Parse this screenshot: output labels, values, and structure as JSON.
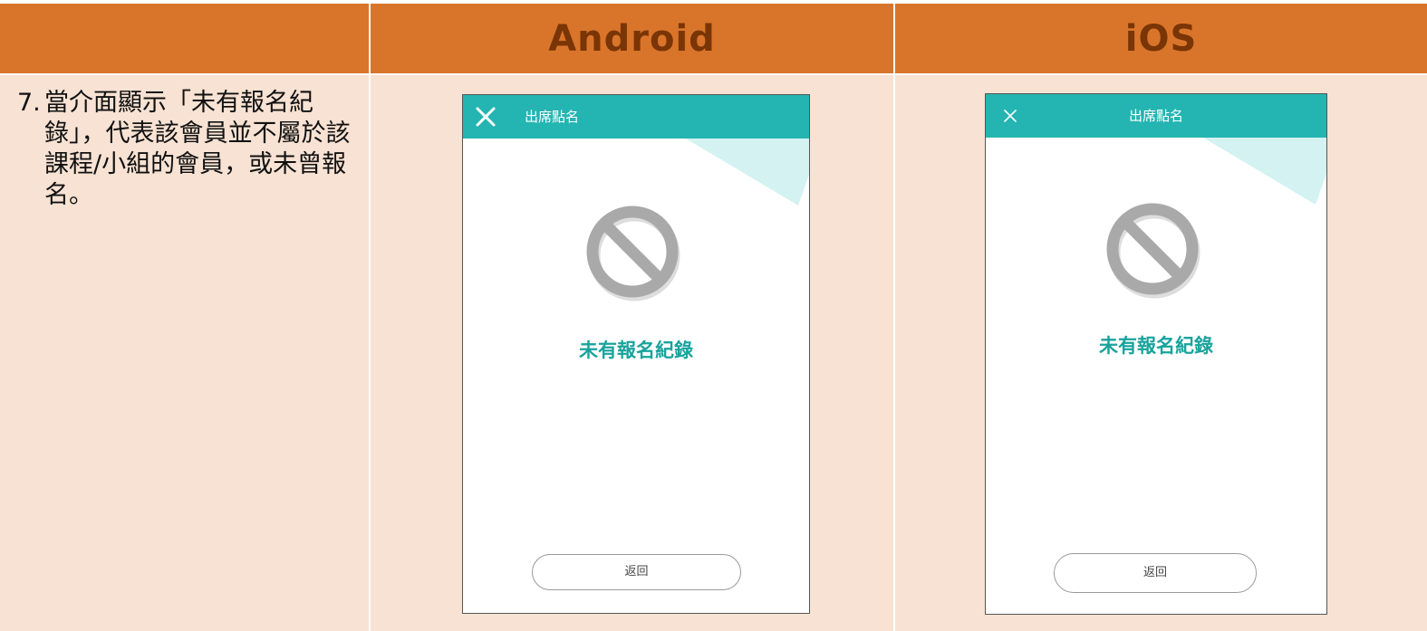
{
  "header": {
    "col1": "",
    "android": "Android",
    "ios": "iOS"
  },
  "step": {
    "number": "7.",
    "text": "當介面顯示「未有報名紀錄」，代表該會員並不屬於該課程/小組的會員，或未曾報名。"
  },
  "android_screen": {
    "title": "出席點名",
    "close_icon": "close-icon",
    "status_icon": "ban-icon",
    "message": "未有報名紀錄",
    "back_button": "返回"
  },
  "ios_screen": {
    "title": "出席點名",
    "close_icon": "close-icon",
    "status_icon": "ban-icon",
    "message": "未有報名紀錄",
    "back_button": "返回"
  },
  "colors": {
    "header_bg": "#d9752a",
    "header_text": "#7a3506",
    "body_bg": "#f7e2d3",
    "app_bar": "#24b5b2",
    "message_text": "#19a39c",
    "decor_triangle": "#d3f2f1",
    "icon_gray": "#a9a9a9"
  }
}
